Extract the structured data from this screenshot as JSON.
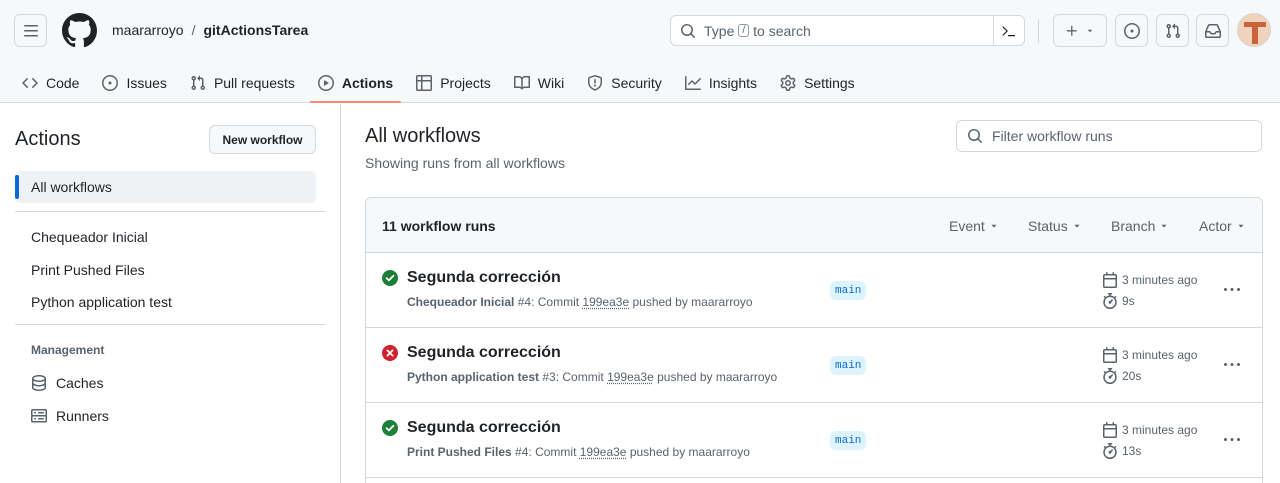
{
  "header": {
    "owner": "maararroyo",
    "separator": "/",
    "repo": "gitActionsTarea",
    "search_prefix": "Type",
    "search_key": "/",
    "search_suffix": "to search"
  },
  "nav": {
    "tabs": [
      {
        "label": "Code",
        "icon": "code-icon"
      },
      {
        "label": "Issues",
        "icon": "issue-opened-icon"
      },
      {
        "label": "Pull requests",
        "icon": "git-pull-request-icon"
      },
      {
        "label": "Actions",
        "icon": "play-icon",
        "active": true
      },
      {
        "label": "Projects",
        "icon": "table-icon"
      },
      {
        "label": "Wiki",
        "icon": "book-icon"
      },
      {
        "label": "Security",
        "icon": "shield-icon"
      },
      {
        "label": "Insights",
        "icon": "graph-icon"
      },
      {
        "label": "Settings",
        "icon": "gear-icon"
      }
    ]
  },
  "sidebar": {
    "title": "Actions",
    "new_workflow": "New workflow",
    "all_workflows": "All workflows",
    "workflows": [
      "Chequeador Inicial",
      "Print Pushed Files",
      "Python application test"
    ],
    "management_heading": "Management",
    "caches": "Caches",
    "runners": "Runners"
  },
  "main": {
    "title": "All workflows",
    "subtitle": "Showing runs from all workflows",
    "filter_placeholder": "Filter workflow runs",
    "runs_count": "11 workflow runs",
    "filters": [
      "Event",
      "Status",
      "Branch",
      "Actor"
    ],
    "runs": [
      {
        "status": "success",
        "title": "Segunda corrección",
        "workflow": "Chequeador Inicial",
        "number": "#4",
        "commit_prefix": ": Commit",
        "sha": "199ea3e",
        "pushed_by": "pushed by maararroyo",
        "branch": "main",
        "time": "3 minutes ago",
        "duration": "9s"
      },
      {
        "status": "failure",
        "title": "Segunda corrección",
        "workflow": "Python application test",
        "number": "#3",
        "commit_prefix": ": Commit",
        "sha": "199ea3e",
        "pushed_by": "pushed by maararroyo",
        "branch": "main",
        "time": "3 minutes ago",
        "duration": "20s"
      },
      {
        "status": "success",
        "title": "Segunda corrección",
        "workflow": "Print Pushed Files",
        "number": "#4",
        "commit_prefix": ": Commit",
        "sha": "199ea3e",
        "pushed_by": "pushed by maararroyo",
        "branch": "main",
        "time": "3 minutes ago",
        "duration": "13s"
      }
    ]
  },
  "colors": {
    "success": "#1a7f37",
    "failure": "#cf222e",
    "accent": "#0969da",
    "underline": "#fd8c73"
  }
}
